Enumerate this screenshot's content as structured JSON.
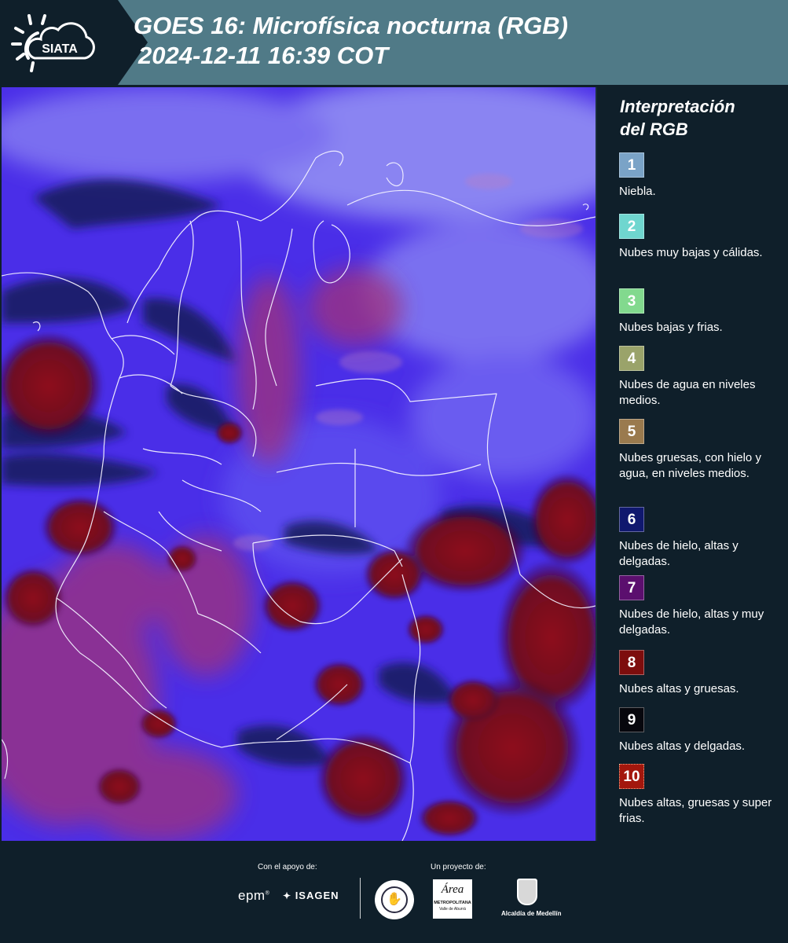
{
  "header": {
    "logo_text": "SIATA",
    "title_line1": "GOES 16: Microfísica nocturna (RGB)",
    "title_line2": "2024-12-11 16:39 COT"
  },
  "legend": {
    "title_line1": "Interpretación",
    "title_line2": "del RGB",
    "items": [
      {
        "num": "1",
        "color": "#7aa3c7",
        "label": "Niebla."
      },
      {
        "num": "2",
        "color": "#6fd6cf",
        "label": "Nubes muy bajas y cálidas."
      },
      {
        "num": "3",
        "color": "#82d98e",
        "label": "Nubes bajas y frias."
      },
      {
        "num": "4",
        "color": "#9aa36a",
        "label": "Nubes de agua en niveles medios."
      },
      {
        "num": "5",
        "color": "#9a7a4e",
        "label": "Nubes gruesas, con hielo y agua, en niveles medios."
      },
      {
        "num": "6",
        "color": "#10186e",
        "label": "Nubes de hielo, altas y delgadas."
      },
      {
        "num": "7",
        "color": "#5b0f6e",
        "label": "Nubes de hielo, altas y muy delgadas."
      },
      {
        "num": "8",
        "color": "#7d0d0d",
        "label": "Nubes altas y gruesas."
      },
      {
        "num": "9",
        "color": "#07070d",
        "label": "Nubes altas y delgadas."
      },
      {
        "num": "10",
        "color": "#a3170d",
        "label": "Nubes altas, gruesas y super frias."
      }
    ]
  },
  "footer": {
    "support_label": "Con el apoyo de:",
    "project_label": "Un proyecto de:",
    "epm_text": "epm",
    "isagen_text": "ISAGEN",
    "metropolitana_word": "Área",
    "metropolitana_text": "METROPOLITANA",
    "metropolitana_sub": "Valle de Aburrá",
    "alcaldia_text": "Alcaldía de Medellín"
  }
}
